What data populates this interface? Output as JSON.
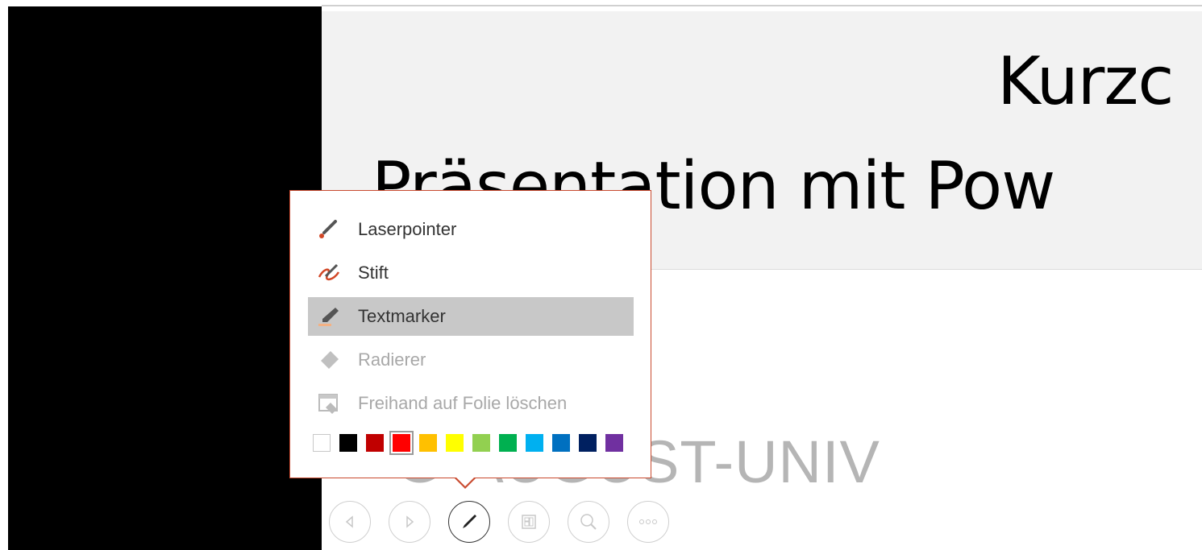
{
  "slide": {
    "title_line1": "Kurzc",
    "title_line2": "Präsentation mit Pow",
    "university_text": "G-AUGUST-UNIV"
  },
  "pointer_menu": {
    "items": [
      {
        "label": "Laserpointer",
        "icon": "laser-pointer-icon",
        "state": "normal"
      },
      {
        "label": "Stift",
        "icon": "pen-icon",
        "state": "normal"
      },
      {
        "label": "Textmarker",
        "icon": "highlighter-icon",
        "state": "selected"
      },
      {
        "label": "Radierer",
        "icon": "eraser-icon",
        "state": "disabled"
      },
      {
        "label": "Freihand auf Folie löschen",
        "icon": "erase-all-ink-icon",
        "state": "disabled"
      }
    ],
    "colors": [
      "#ffffff",
      "#000000",
      "#c00000",
      "#ff0000",
      "#ffc000",
      "#ffff00",
      "#92d050",
      "#00b050",
      "#00b0f0",
      "#0070c0",
      "#002060",
      "#7030a0"
    ],
    "selected_color": "#ff0000",
    "accent_border": "#c94a2f"
  },
  "controls": {
    "buttons": [
      "previous-slide-icon",
      "next-slide-icon",
      "pen-tool-icon",
      "see-all-slides-icon",
      "zoom-icon",
      "more-options-icon"
    ],
    "active": "pen-tool-icon"
  }
}
